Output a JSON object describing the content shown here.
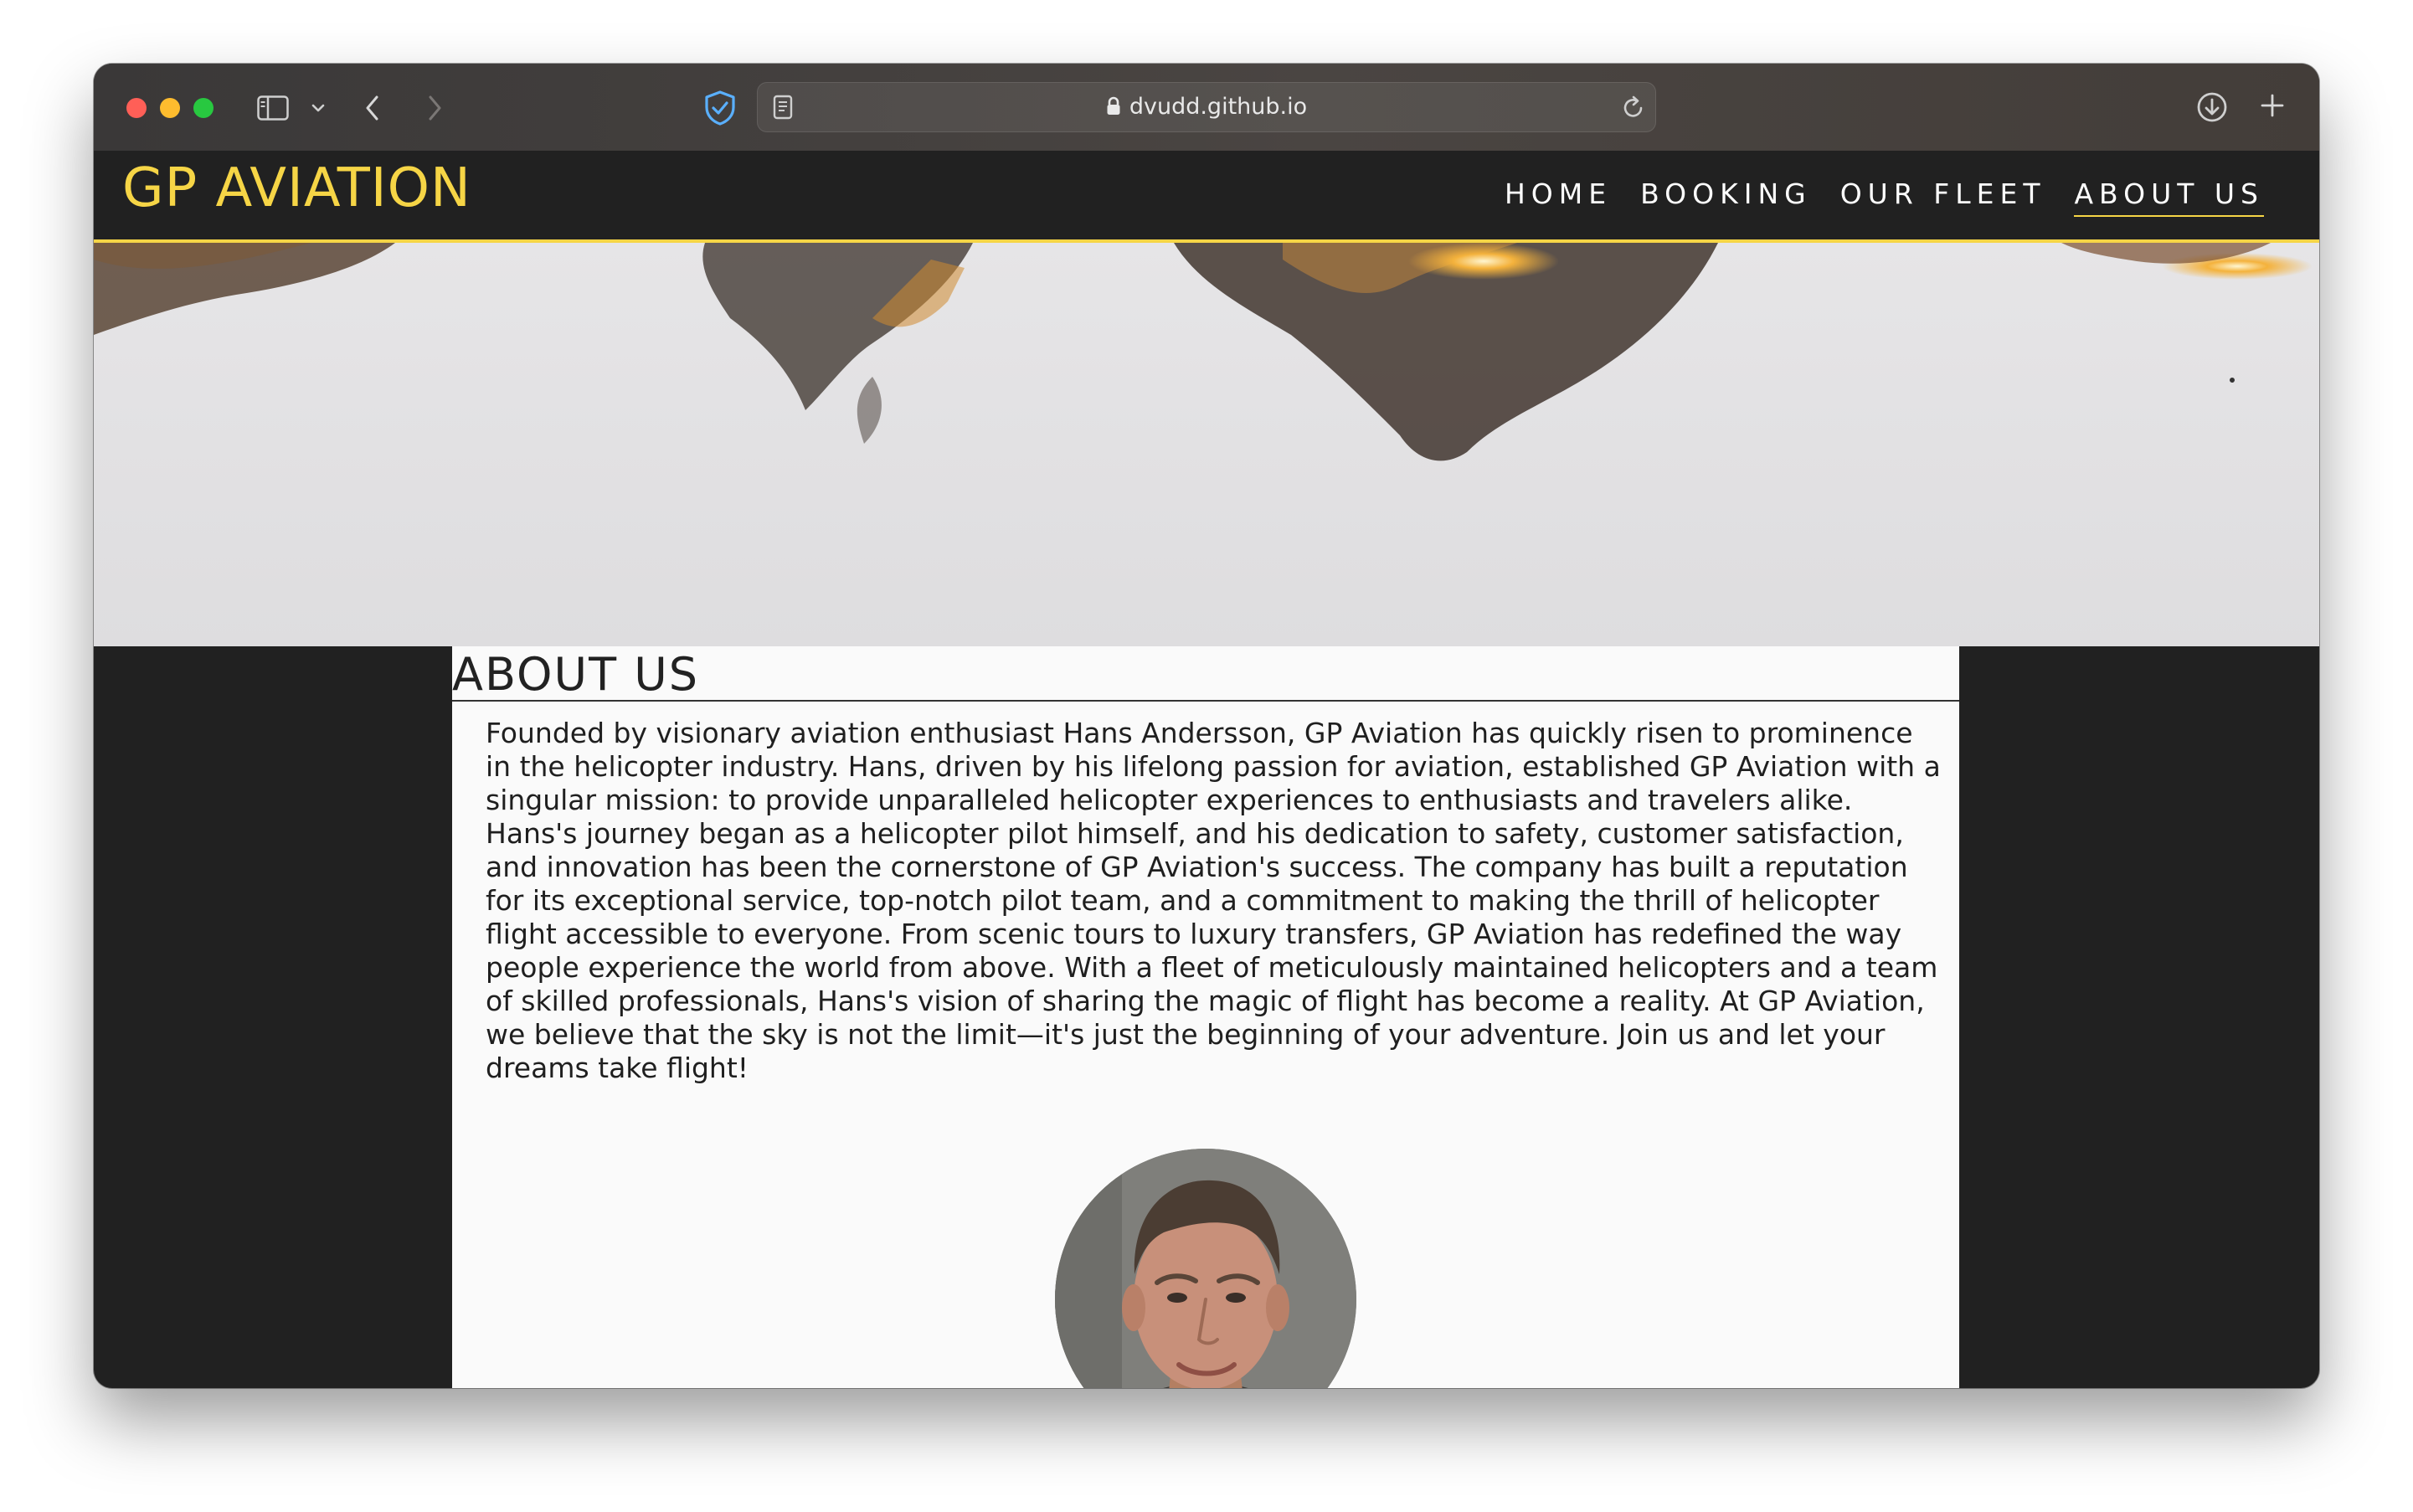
{
  "browser": {
    "url": "dvudd.github.io",
    "icons": {
      "sidebar": "sidebar-icon",
      "back": "chevron-left-icon",
      "forward": "chevron-right-icon",
      "privacy": "shield-check-icon",
      "reader": "reader-icon",
      "lock": "lock-icon",
      "reload": "reload-icon",
      "download": "download-icon",
      "new_tab": "plus-icon"
    }
  },
  "site": {
    "brand": "GP AVIATION",
    "nav": [
      {
        "label": "HOME",
        "active": false
      },
      {
        "label": "BOOKING",
        "active": false
      },
      {
        "label": "OUR FLEET",
        "active": false
      },
      {
        "label": "ABOUT US",
        "active": true
      }
    ],
    "accent_color": "#f6d546",
    "background_color": "#212121"
  },
  "about": {
    "title": "ABOUT US",
    "body": "Founded by visionary aviation enthusiast Hans Andersson, GP Aviation has quickly risen to prominence in the helicopter industry. Hans, driven by his lifelong passion for aviation, established GP Aviation with a singular mission: to provide unparalleled helicopter experiences to enthusiasts and travelers alike. Hans's journey began as a helicopter pilot himself, and his dedication to safety, customer satisfaction, and innovation has been the cornerstone of GP Aviation's success. The company has built a reputation for its exceptional service, top-notch pilot team, and a commitment to making the thrill of helicopter flight accessible to everyone. From scenic tours to luxury transfers, GP Aviation has redefined the way people experience the world from above. With a fleet of meticulously maintained helicopters and a team of skilled professionals, Hans's vision of sharing the magic of flight has become a reality. At GP Aviation, we believe that the sky is not the limit—it's just the beginning of your adventure. Join us and let your dreams take flight!"
  }
}
